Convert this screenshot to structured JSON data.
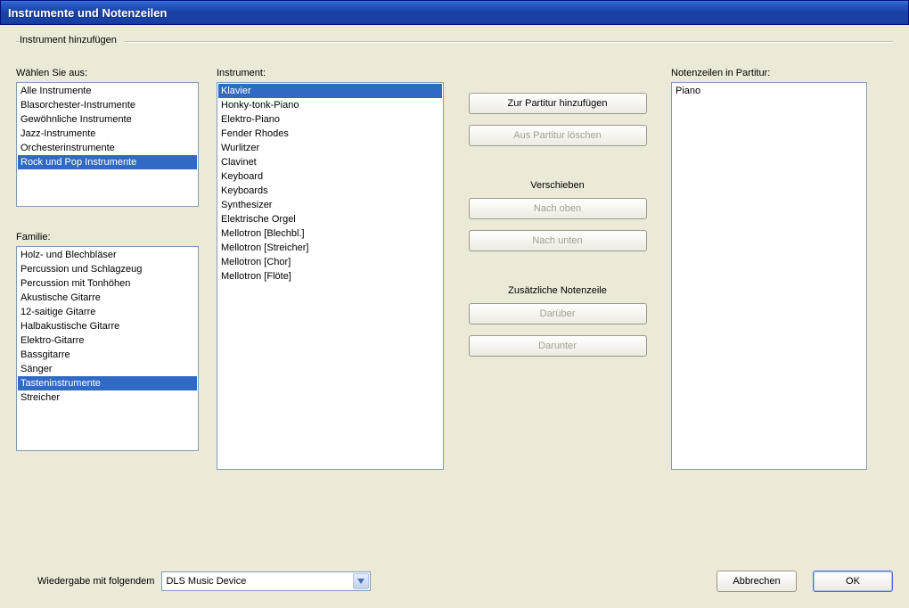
{
  "window": {
    "title": "Instrumente und Notenzeilen"
  },
  "group": {
    "title": "Instrument hinzufügen"
  },
  "labels": {
    "section": "Wählen Sie aus:",
    "family": "Familie:",
    "instrument": "Instrument:",
    "staves": "Notenzeilen in Partitur:",
    "move": "Verschieben",
    "extra": "Zusätzliche Notenzeile",
    "playback": "Wiedergabe mit folgendem"
  },
  "sections": {
    "items": [
      "Alle Instrumente",
      "Blasorchester-Instrumente",
      "Gewöhnliche Instrumente",
      "Jazz-Instrumente",
      "Orchesterinstrumente",
      "Rock und Pop Instrumente"
    ],
    "selectedIndex": 5
  },
  "families": {
    "items": [
      "Holz- und Blechbläser",
      "Percussion und Schlagzeug",
      "Percussion mit Tonhöhen",
      "Akustische Gitarre",
      "12-saitige Gitarre",
      "Halbakustische Gitarre",
      "Elektro-Gitarre",
      "Bassgitarre",
      "Sänger",
      "Tasteninstrumente",
      "Streicher"
    ],
    "selectedIndex": 9
  },
  "instruments": {
    "items": [
      "Klavier",
      "Honky-tonk-Piano",
      "Elektro-Piano",
      "Fender Rhodes",
      "Wurlitzer",
      "Clavinet",
      "Keyboard",
      "Keyboards",
      "Synthesizer",
      "Elektrische Orgel",
      "Mellotron [Blechbl.]",
      "Mellotron [Streicher]",
      "Mellotron [Chor]",
      "Mellotron [Flöte]"
    ],
    "selectedIndex": 0
  },
  "staves": {
    "items": [
      "Piano"
    ],
    "selectedIndex": -1
  },
  "buttons": {
    "add": "Zur Partitur hinzufügen",
    "delete": "Aus Partitur löschen",
    "up": "Nach oben",
    "down": "Nach unten",
    "above": "Darüber",
    "below": "Darunter",
    "cancel": "Abbrechen",
    "ok": "OK"
  },
  "playback": {
    "selected": "DLS Music Device"
  }
}
